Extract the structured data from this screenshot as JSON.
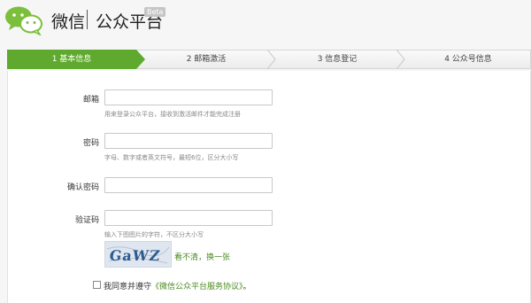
{
  "header": {
    "brand": "微信",
    "platform": "公众平台",
    "badge": "Beta"
  },
  "steps": [
    {
      "label": "1 基本信息",
      "active": true
    },
    {
      "label": "2 邮箱激活",
      "active": false
    },
    {
      "label": "3 信息登记",
      "active": false
    },
    {
      "label": "4 公众号信息",
      "active": false
    }
  ],
  "form": {
    "email": {
      "label": "邮箱",
      "hint": "用来登录公众平台，接收到激活邮件才能完成注册"
    },
    "password": {
      "label": "密码",
      "hint": "字母、数字或者英文符号，最短6位，区分大小写"
    },
    "confirm": {
      "label": "确认密码"
    },
    "captcha": {
      "label": "验证码",
      "hint": "输入下图图片的字符，不区分大小写",
      "image_text": "GaWZ",
      "refresh": "看不清，换一张"
    }
  },
  "agreement": {
    "prefix": "我同意并遵守",
    "link": "《微信公众平台服务协议》",
    "suffix": "。"
  },
  "colors": {
    "accent": "#5faa2e",
    "link": "#4a8a1e",
    "logo": "#7cbf3c"
  }
}
